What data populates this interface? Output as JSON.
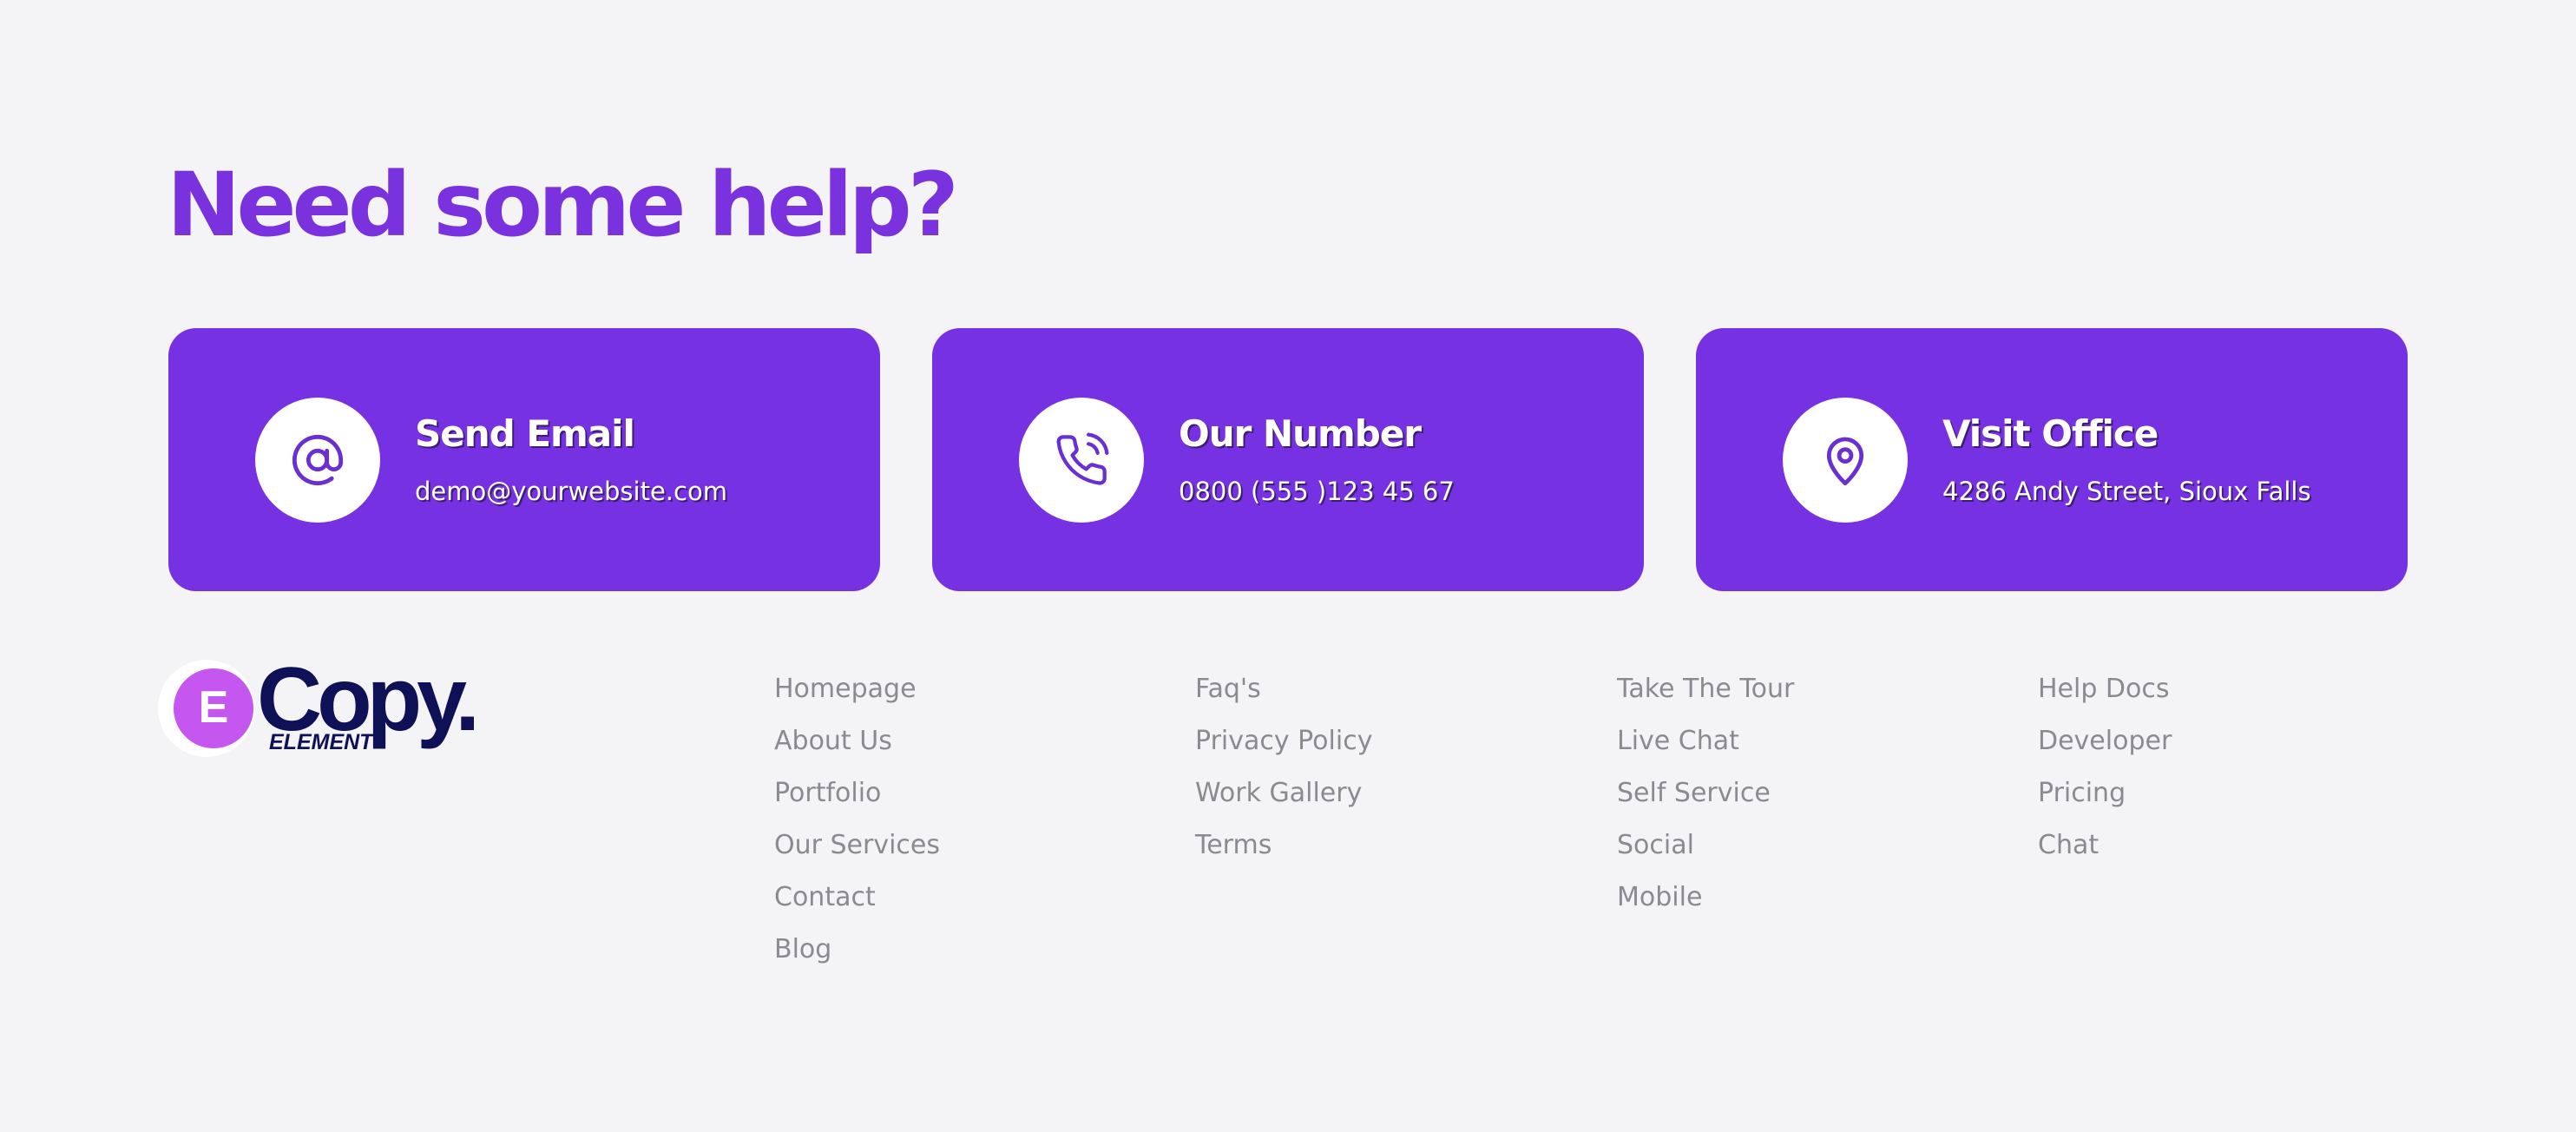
{
  "help": {
    "title": "Need some help?"
  },
  "cards": [
    {
      "icon": "at-sign-icon",
      "title": "Send Email",
      "detail": "demo@yourwebsite.com"
    },
    {
      "icon": "phone-icon",
      "title": "Our Number",
      "detail": "0800 (555 )123 45 67"
    },
    {
      "icon": "map-pin-icon",
      "title": "Visit Office",
      "detail": "4286 Andy Street, Sioux Falls"
    }
  ],
  "logo": {
    "wordmark": "Copy.",
    "subtitle": "ELEMENT",
    "mark_letter": "E"
  },
  "footer": {
    "columns": [
      [
        "Homepage",
        "About Us",
        "Portfolio",
        "Our Services",
        "Contact",
        "Blog"
      ],
      [
        "Faq's",
        "Privacy Policy",
        "Work Gallery",
        "Terms"
      ],
      [
        "Take The Tour",
        "Live Chat",
        "Self Service",
        "Social",
        "Mobile"
      ],
      [
        "Help Docs",
        "Developer",
        "Pricing",
        "Chat"
      ]
    ]
  },
  "colors": {
    "accent": "#7531e2",
    "heading": "#7a32df",
    "background": "#f4f4f6",
    "link": "#8a8a91",
    "logo_text": "#0f1156",
    "logo_mark": "#c656f0"
  }
}
